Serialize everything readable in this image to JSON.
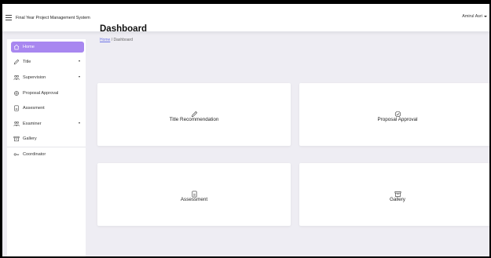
{
  "header": {
    "app_title": "Final Year Project Management System",
    "user_name": "Amirul Asri"
  },
  "sidebar": {
    "items": [
      {
        "label": "Home",
        "icon": "home-icon",
        "active": true,
        "has_caret": false
      },
      {
        "label": "Title",
        "icon": "pencil-icon",
        "active": false,
        "has_caret": true
      },
      {
        "label": "Supervision",
        "icon": "users-icon",
        "active": false,
        "has_caret": true
      },
      {
        "label": "Proposal Approval",
        "icon": "approval-icon",
        "active": false,
        "has_caret": false
      },
      {
        "label": "Assesment",
        "icon": "document-icon",
        "active": false,
        "has_caret": false
      },
      {
        "label": "Examiner",
        "icon": "users-icon",
        "active": false,
        "has_caret": true
      },
      {
        "label": "Gallery",
        "icon": "archive-icon",
        "active": false,
        "has_caret": false
      },
      {
        "label": "Coordinator",
        "icon": "key-icon",
        "active": false,
        "has_caret": false
      }
    ]
  },
  "main": {
    "title": "Dashboard",
    "breadcrumb": {
      "home": "Home",
      "separator": "/",
      "current": "Dashboard"
    },
    "cards": [
      {
        "label": "Title Recommendation",
        "icon": "pencil-icon"
      },
      {
        "label": "Proposal Approval",
        "icon": "check-circle-icon"
      },
      {
        "label": "Assessment",
        "icon": "document-icon"
      },
      {
        "label": "Gallery",
        "icon": "archive-icon"
      }
    ]
  },
  "colors": {
    "accent": "#a887f0",
    "page_bg": "#eeedf3",
    "link": "#6d74e6"
  }
}
